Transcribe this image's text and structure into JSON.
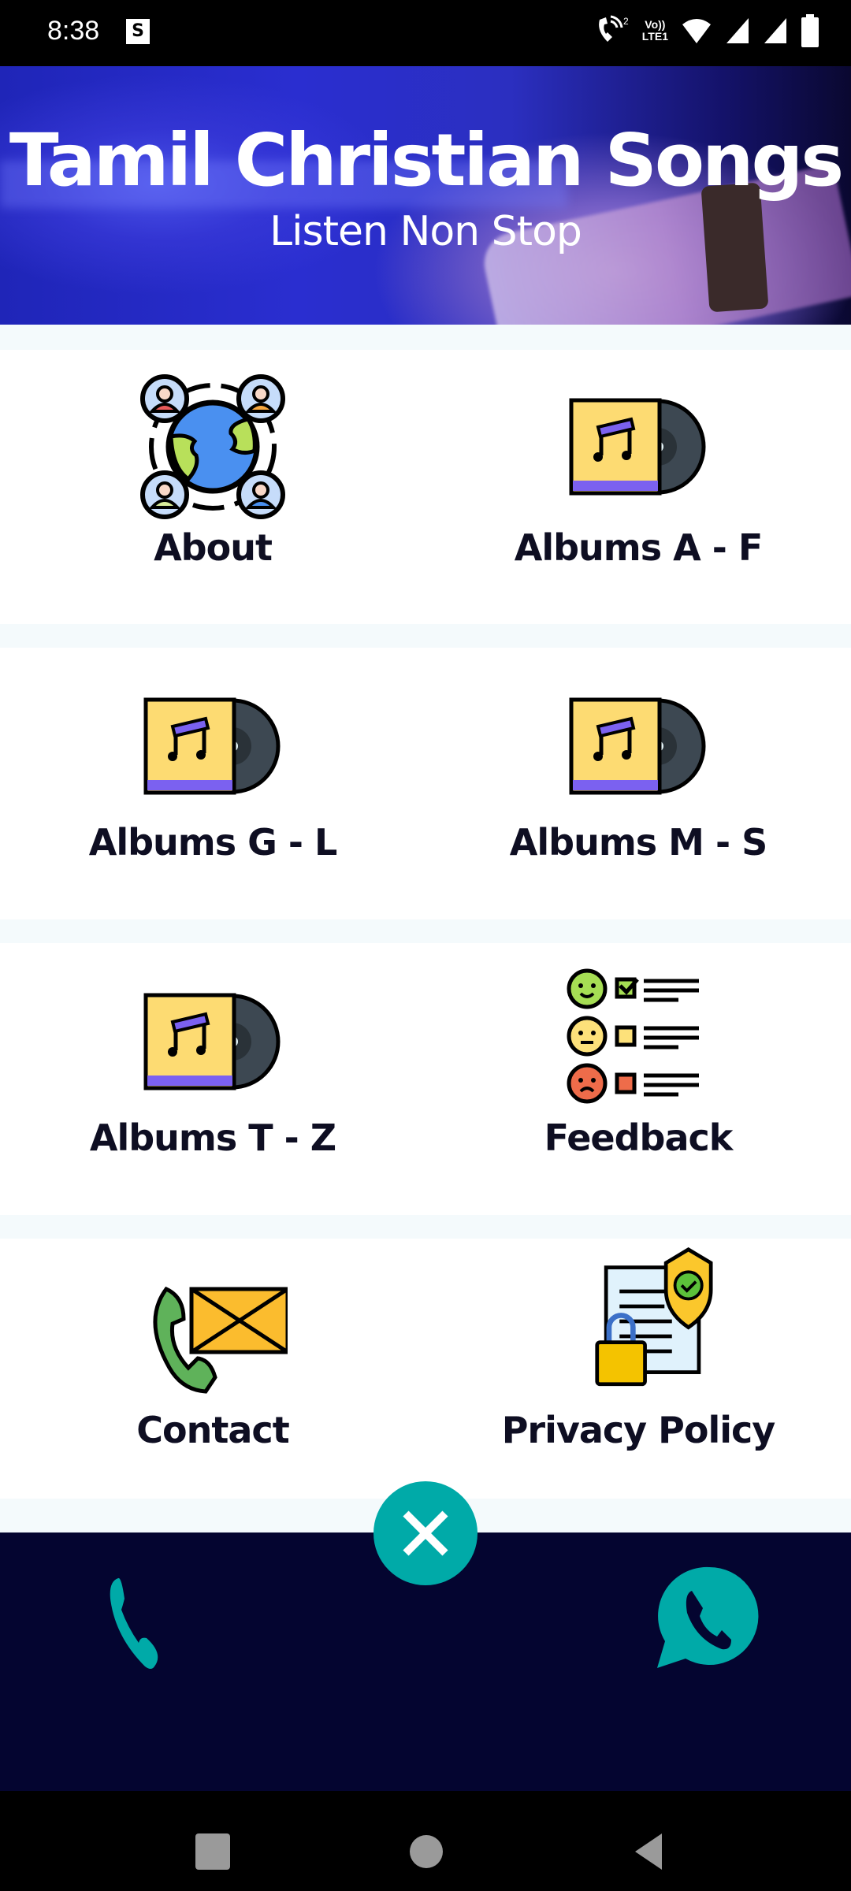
{
  "status_bar": {
    "time": "8:38",
    "notification_icons": [
      "screenshot-icon"
    ],
    "system_icons": [
      "wifi-calling-icon",
      "volte-lte1-icon",
      "wifi-icon",
      "signal-icon",
      "signal-icon-2",
      "battery-icon"
    ],
    "volte_label_top": "Vo))",
    "volte_label_bottom": "LTE1",
    "call_sim": "2"
  },
  "banner": {
    "title": "Tamil Christian Songs",
    "subtitle": "Listen Non Stop"
  },
  "menu": [
    {
      "label": "About",
      "icon": "community-globe-icon"
    },
    {
      "label": "Albums A - F",
      "icon": "vinyl-album-icon"
    },
    {
      "label": "Albums G - L",
      "icon": "vinyl-album-icon"
    },
    {
      "label": "Albums M - S",
      "icon": "vinyl-album-icon"
    },
    {
      "label": "Albums T - Z",
      "icon": "vinyl-album-icon"
    },
    {
      "label": "Feedback",
      "icon": "feedback-survey-icon"
    },
    {
      "label": "Contact",
      "icon": "phone-mail-icon"
    },
    {
      "label": "Privacy Policy",
      "icon": "privacy-document-icon"
    }
  ],
  "bottom_bar": {
    "left_action": "phone-icon",
    "center_action": "close-icon",
    "right_action": "whatsapp-icon"
  },
  "colors": {
    "accent": "#00aaa8",
    "bottom_bar": "#040530",
    "label_text": "#0e0e22"
  },
  "nav_bar": [
    "recents-button",
    "home-button",
    "back-button"
  ]
}
